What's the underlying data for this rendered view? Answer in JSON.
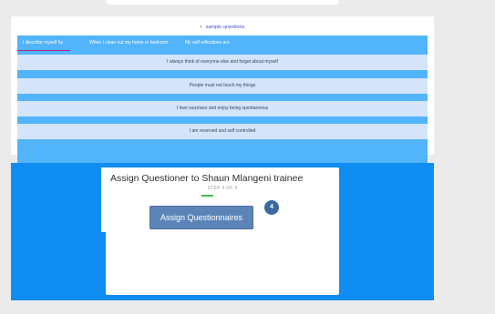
{
  "questions_card": {
    "sample_link": "sample questions",
    "tabs": [
      {
        "label": "I describe myself by"
      },
      {
        "label": "When I clean out my home or bedroom"
      },
      {
        "label": "My self reflections are"
      }
    ],
    "rows": [
      {
        "text": "I always think of everyone else and forget about myself"
      },
      {
        "text": "People must not touch my things"
      },
      {
        "text": "I love surprises and enjoy being spontaneous"
      },
      {
        "text": "I am reserved and self controlled"
      }
    ]
  },
  "assign_dialog": {
    "title": "Assign Questioner to Shaun Mlangeni trainee",
    "step_label": "STEP 4 OF 4",
    "step_progress": 1.0,
    "button_label": "Assign Questionnaires",
    "step_badge": "4"
  },
  "colors": {
    "page_bg": "#ebebeb",
    "tab_bar": "#52b4fa",
    "row_bg": "#d3e4fb",
    "active_tab_underline": "#b0227a",
    "assign_panel": "#0f8df3",
    "button": "#5b85b8",
    "progress": "#3fbf4f"
  }
}
